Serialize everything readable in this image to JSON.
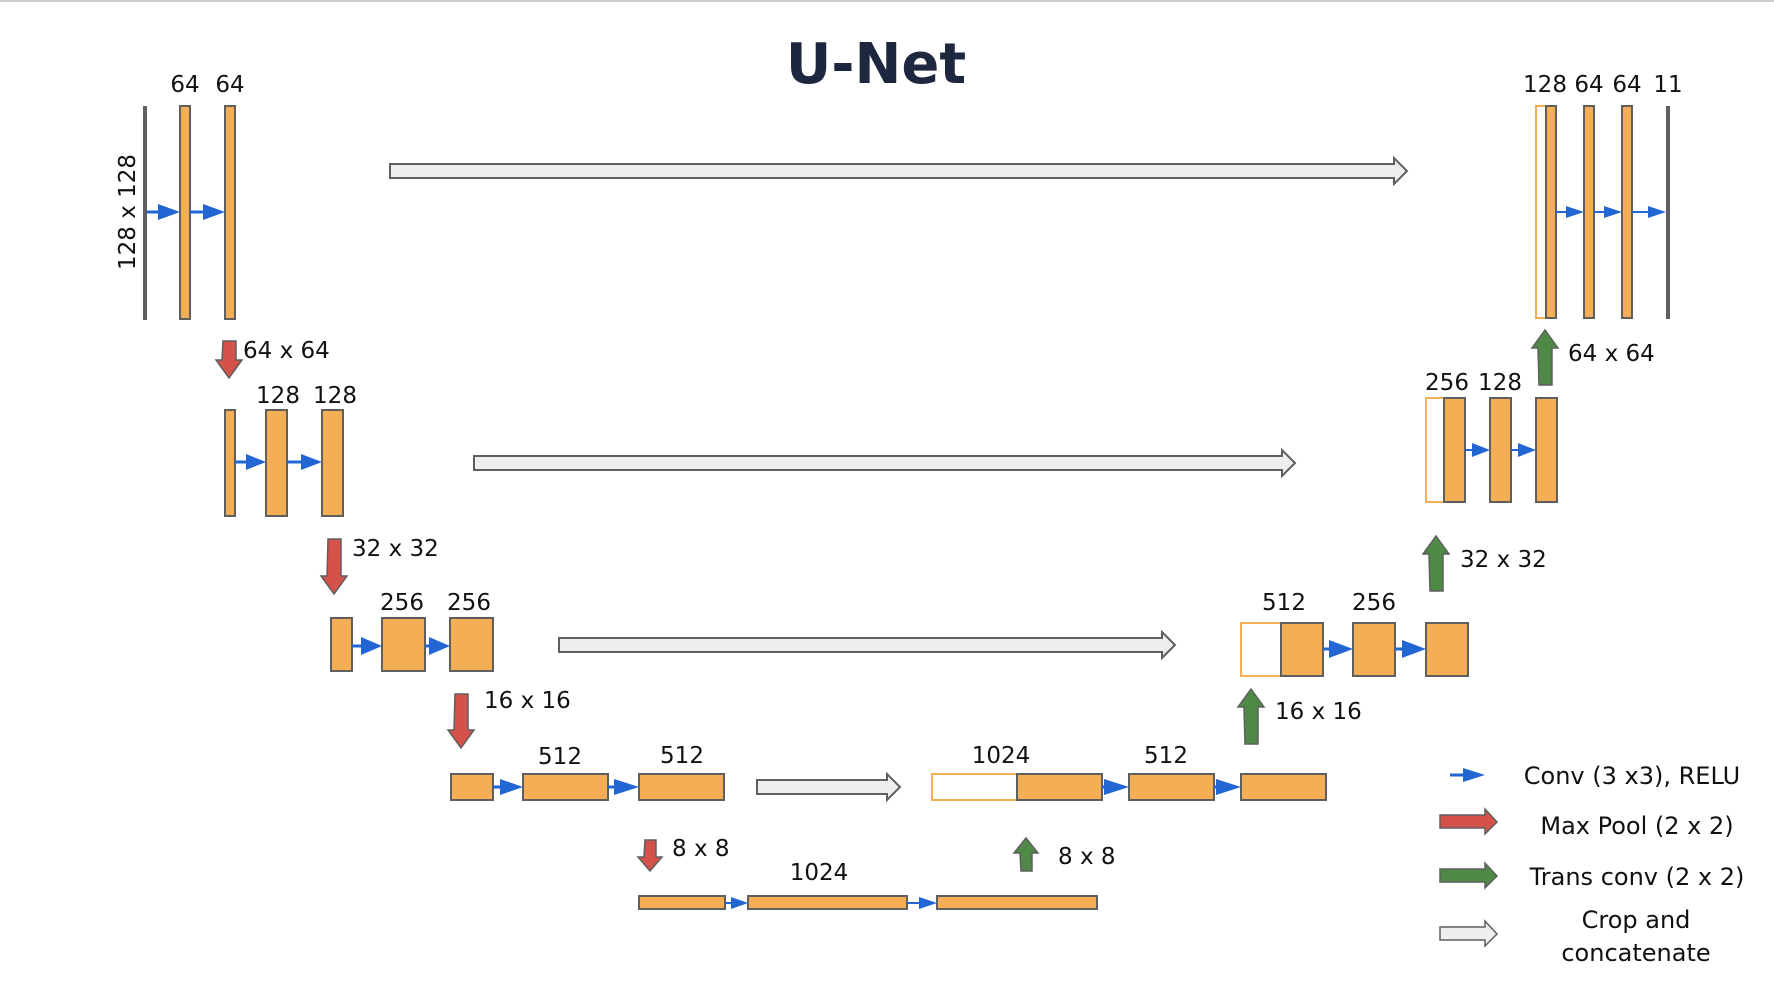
{
  "title": "U-Net",
  "colors": {
    "feature_map": "#f3ae56",
    "feature_map_stroke": "#5f5f5f",
    "copied_map_stroke": "#f3ae56",
    "conv_arrow": "#2266d4",
    "maxpool_arrow": "#d4524a",
    "transconv_arrow": "#4e8a45",
    "concat_arrow": "#eeeeee",
    "title": "#1e2740"
  },
  "encoder": {
    "input_size": "128 x 128",
    "level1": {
      "channels": [
        "64",
        "64"
      ]
    },
    "pool1": "64 x 64",
    "level2": {
      "channels": [
        "128",
        "128"
      ]
    },
    "pool2": "32 x 32",
    "level3": {
      "channels": [
        "256",
        "256"
      ]
    },
    "pool3": "16 x 16",
    "level4": {
      "channels": [
        "512",
        "512"
      ]
    },
    "pool4": "8 x 8"
  },
  "bottleneck": {
    "channels": "1024",
    "up_size": "8 x 8"
  },
  "decoder": {
    "level4": {
      "channels": [
        "1024",
        "512"
      ],
      "up_size": "16 x 16"
    },
    "level3": {
      "channels": [
        "512",
        "256"
      ],
      "up_size": "32 x 32"
    },
    "level2": {
      "channels": [
        "256",
        "128"
      ],
      "up_size": "64 x 64"
    },
    "level1": {
      "channels": [
        "128",
        "64",
        "64",
        "11"
      ]
    }
  },
  "legend": [
    {
      "icon": "conv-arrow-icon",
      "label": "Conv (3 x3), RELU"
    },
    {
      "icon": "maxpool-arrow-icon",
      "label": "Max Pool (2 x 2)"
    },
    {
      "icon": "transconv-arrow-icon",
      "label": "Trans conv (2 x 2)"
    },
    {
      "icon": "concat-arrow-icon",
      "label_line1": "Crop and",
      "label_line2": "concatenate"
    }
  ]
}
